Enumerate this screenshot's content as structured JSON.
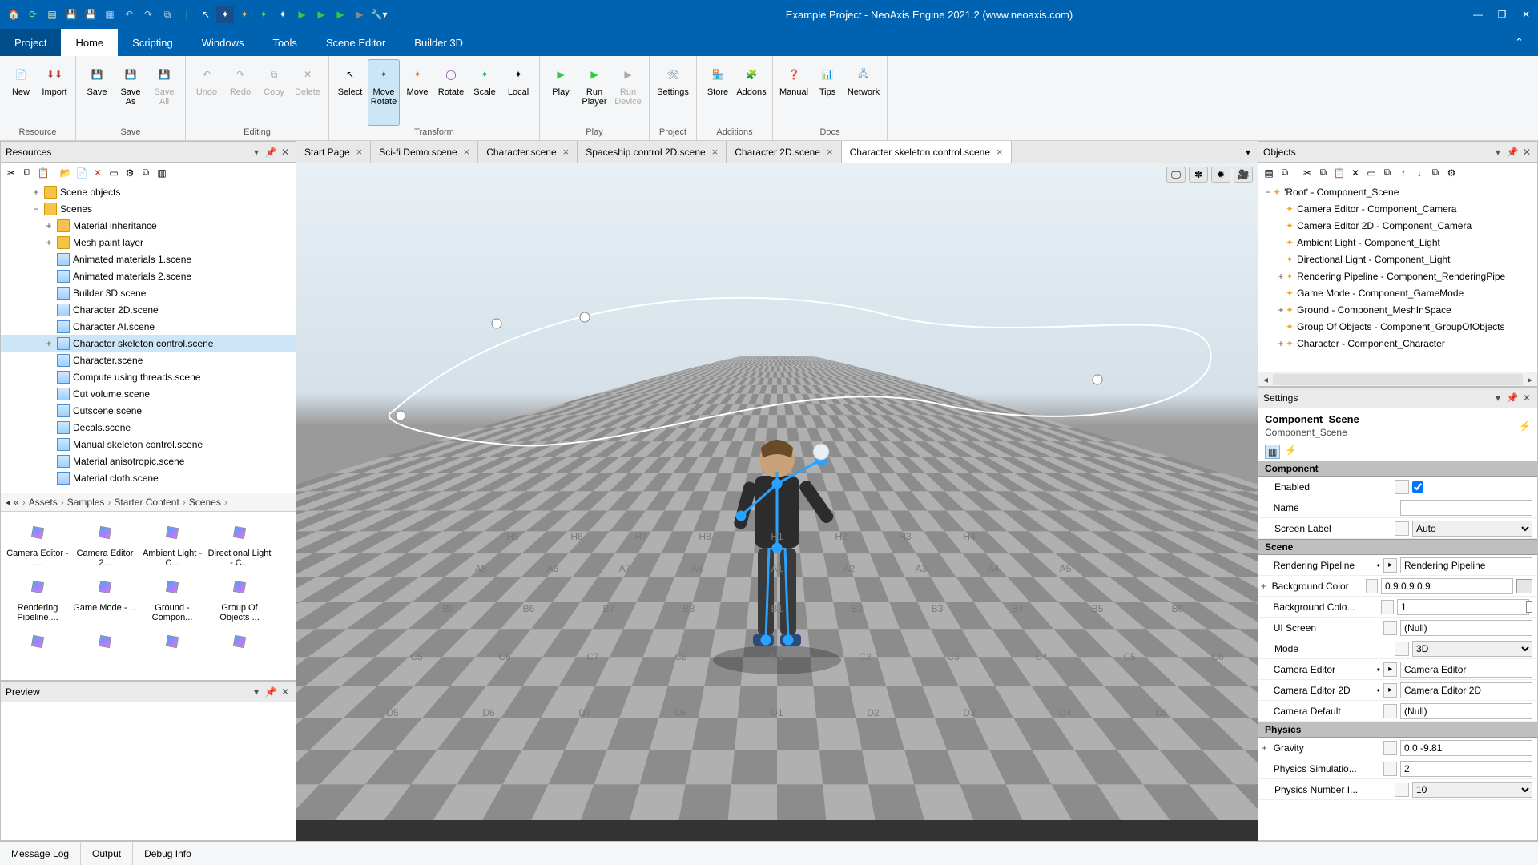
{
  "title": "Example Project - NeoAxis Engine 2021.2 (www.neoaxis.com)",
  "menutabs": {
    "file": "Project",
    "home": "Home",
    "scripting": "Scripting",
    "windows": "Windows",
    "tools": "Tools",
    "scene": "Scene Editor",
    "builder": "Builder 3D"
  },
  "ribbon": {
    "resource": {
      "label": "Resource",
      "new": "New",
      "import": "Import"
    },
    "save": {
      "label": "Save",
      "save": "Save",
      "saveas": "Save\nAs",
      "saveall": "Save\nAll"
    },
    "editing": {
      "label": "Editing",
      "undo": "Undo",
      "redo": "Redo",
      "copy": "Copy",
      "delete": "Delete"
    },
    "transform": {
      "label": "Transform",
      "select": "Select",
      "moverotate": "Move\nRotate",
      "move": "Move",
      "rotate": "Rotate",
      "scale": "Scale",
      "local": "Local"
    },
    "play": {
      "label": "Play",
      "play": "Play",
      "runplayer": "Run\nPlayer",
      "rundevice": "Run\nDevice"
    },
    "project": {
      "label": "Project",
      "settings": "Settings"
    },
    "additions": {
      "label": "Additions",
      "store": "Store",
      "addons": "Addons"
    },
    "docs": {
      "label": "Docs",
      "manual": "Manual",
      "tips": "Tips",
      "network": "Network"
    }
  },
  "resources": {
    "title": "Resources",
    "tree": [
      {
        "indent": 2,
        "tw": "+",
        "kind": "folder",
        "label": "Scene objects"
      },
      {
        "indent": 2,
        "tw": "−",
        "kind": "folder",
        "label": "Scenes"
      },
      {
        "indent": 3,
        "tw": "+",
        "kind": "folder",
        "label": "Material inheritance"
      },
      {
        "indent": 3,
        "tw": "+",
        "kind": "folder",
        "label": "Mesh paint layer"
      },
      {
        "indent": 3,
        "tw": "",
        "kind": "file",
        "label": "Animated materials 1.scene"
      },
      {
        "indent": 3,
        "tw": "",
        "kind": "file",
        "label": "Animated materials 2.scene"
      },
      {
        "indent": 3,
        "tw": "",
        "kind": "file",
        "label": "Builder 3D.scene"
      },
      {
        "indent": 3,
        "tw": "",
        "kind": "file",
        "label": "Character 2D.scene"
      },
      {
        "indent": 3,
        "tw": "",
        "kind": "file",
        "label": "Character AI.scene"
      },
      {
        "indent": 3,
        "tw": "+",
        "kind": "file",
        "label": "Character skeleton control.scene",
        "sel": true
      },
      {
        "indent": 3,
        "tw": "",
        "kind": "file",
        "label": "Character.scene"
      },
      {
        "indent": 3,
        "tw": "",
        "kind": "file",
        "label": "Compute using threads.scene"
      },
      {
        "indent": 3,
        "tw": "",
        "kind": "file",
        "label": "Cut volume.scene"
      },
      {
        "indent": 3,
        "tw": "",
        "kind": "file",
        "label": "Cutscene.scene"
      },
      {
        "indent": 3,
        "tw": "",
        "kind": "file",
        "label": "Decals.scene"
      },
      {
        "indent": 3,
        "tw": "",
        "kind": "file",
        "label": "Manual skeleton control.scene"
      },
      {
        "indent": 3,
        "tw": "",
        "kind": "file",
        "label": "Material anisotropic.scene"
      },
      {
        "indent": 3,
        "tw": "",
        "kind": "file",
        "label": "Material cloth.scene"
      }
    ],
    "breadcrumb": [
      "«",
      "Assets",
      "Samples",
      "Starter Content",
      "Scenes"
    ],
    "thumbs": [
      "Camera Editor - ...",
      "Camera Editor 2...",
      "Ambient Light - C...",
      "Directional Light - C...",
      "Rendering Pipeline ...",
      "Game Mode - ...",
      "Ground - Compon...",
      "Group Of Objects ..."
    ]
  },
  "preview": {
    "title": "Preview"
  },
  "doctabs": [
    {
      "label": "Start Page"
    },
    {
      "label": "Sci-fi Demo.scene"
    },
    {
      "label": "Character.scene"
    },
    {
      "label": "Spaceship control 2D.scene"
    },
    {
      "label": "Character 2D.scene"
    },
    {
      "label": "Character skeleton control.scene",
      "active": true
    }
  ],
  "objects": {
    "title": "Objects",
    "tree": [
      {
        "indent": 0,
        "tw": "−",
        "label": "'Root' - Component_Scene"
      },
      {
        "indent": 1,
        "tw": "",
        "label": "Camera Editor - Component_Camera"
      },
      {
        "indent": 1,
        "tw": "",
        "label": "Camera Editor 2D - Component_Camera"
      },
      {
        "indent": 1,
        "tw": "",
        "label": "Ambient Light - Component_Light"
      },
      {
        "indent": 1,
        "tw": "",
        "label": "Directional Light - Component_Light"
      },
      {
        "indent": 1,
        "tw": "+",
        "label": "Rendering Pipeline - Component_RenderingPipe"
      },
      {
        "indent": 1,
        "tw": "",
        "label": "Game Mode - Component_GameMode"
      },
      {
        "indent": 1,
        "tw": "+",
        "label": "Ground - Component_MeshInSpace"
      },
      {
        "indent": 1,
        "tw": "",
        "label": "Group Of Objects - Component_GroupOfObjects"
      },
      {
        "indent": 1,
        "tw": "+",
        "label": "Character - Component_Character"
      }
    ]
  },
  "settings": {
    "title": "Settings",
    "comp_title": "Component_Scene",
    "comp_sub": "Component_Scene",
    "sections": {
      "component": "Component",
      "scene": "Scene",
      "physics": "Physics"
    },
    "props": {
      "enabled": {
        "label": "Enabled",
        "checked": true
      },
      "name": {
        "label": "Name",
        "value": ""
      },
      "screenlabel": {
        "label": "Screen Label",
        "value": "Auto"
      },
      "renderingpipeline": {
        "label": "Rendering Pipeline",
        "value": "Rendering Pipeline"
      },
      "bgcolor": {
        "label": "Background Color",
        "value": "0.9 0.9 0.9"
      },
      "bgcolormult": {
        "label": "Background Colo...",
        "value": "1"
      },
      "uiscreen": {
        "label": "UI Screen",
        "value": "(Null)"
      },
      "mode": {
        "label": "Mode",
        "value": "3D"
      },
      "cameraeditor": {
        "label": "Camera Editor",
        "value": "Camera Editor"
      },
      "cameraeditor2d": {
        "label": "Camera Editor 2D",
        "value": "Camera Editor 2D"
      },
      "cameradefault": {
        "label": "Camera Default",
        "value": "(Null)"
      },
      "gravity": {
        "label": "Gravity",
        "value": "0 0 -9.81"
      },
      "physsim": {
        "label": "Physics Simulatio...",
        "value": "2"
      },
      "physnum": {
        "label": "Physics Number I...",
        "value": "10"
      }
    }
  },
  "status": {
    "msg": "Message Log",
    "out": "Output",
    "dbg": "Debug Info"
  }
}
